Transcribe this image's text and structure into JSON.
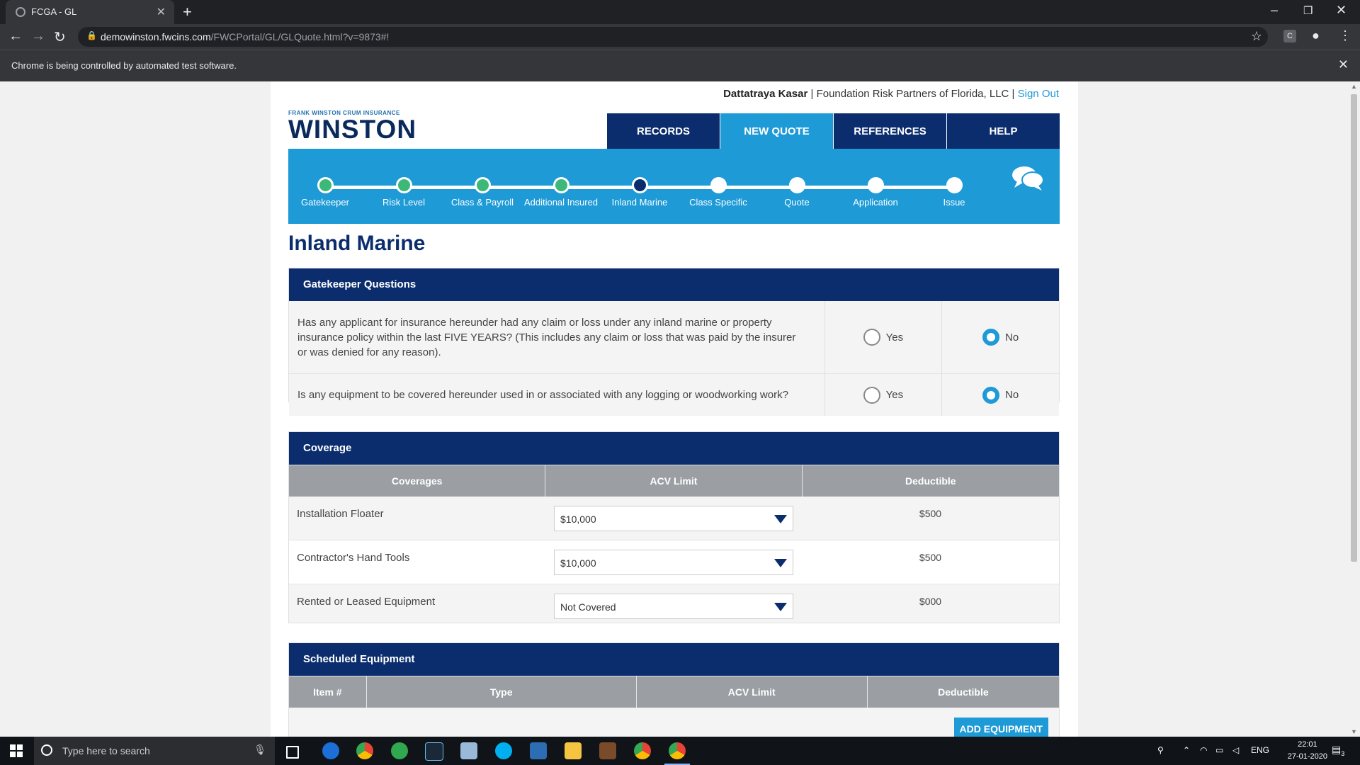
{
  "browser": {
    "tab_title": "FCGA - GL",
    "url_host": "demowinston.fwcins.com",
    "url_path": "/FWCPortal/GL/GLQuote.html?v=9873#!",
    "infobar": "Chrome is being controlled by automated test software.",
    "profile_ext": "C"
  },
  "user": {
    "name": "Dattatraya Kasar",
    "company": "Foundation Risk Partners of Florida, LLC",
    "signout": "Sign Out",
    "separator": "|"
  },
  "logo": {
    "small": "FRANK WINSTON CRUM INSURANCE",
    "big": "WINSTON"
  },
  "nav": {
    "records": "RECORDS",
    "new_quote": "NEW QUOTE",
    "references": "REFERENCES",
    "help": "HELP",
    "active": "NEW QUOTE"
  },
  "steps": [
    {
      "label": "Gatekeeper",
      "state": "done"
    },
    {
      "label": "Risk Level",
      "state": "done"
    },
    {
      "label": "Class & Payroll",
      "state": "done"
    },
    {
      "label": "Additional Insured",
      "state": "done"
    },
    {
      "label": "Inland Marine",
      "state": "current"
    },
    {
      "label": "Class Specific",
      "state": "todo"
    },
    {
      "label": "Quote",
      "state": "todo"
    },
    {
      "label": "Application",
      "state": "todo"
    },
    {
      "label": "Issue",
      "state": "todo"
    }
  ],
  "page_title": "Inland Marine",
  "gatekeeper": {
    "header": "Gatekeeper Questions",
    "yes_label": "Yes",
    "no_label": "No",
    "questions": [
      {
        "text": "Has any applicant for insurance hereunder had any claim or loss under any inland marine or property insurance policy within the last FIVE YEARS? (This includes any claim or loss that was paid by the insurer or was denied for any reason).",
        "answer": "No"
      },
      {
        "text": "Is any equipment to be covered hereunder used in or associated with any logging or woodworking work?",
        "answer": "No"
      }
    ]
  },
  "coverage": {
    "header": "Coverage",
    "columns": [
      "Coverages",
      "ACV Limit",
      "Deductible"
    ],
    "rows": [
      {
        "name": "Installation Floater",
        "limit": "$10,000",
        "deductible": "$500"
      },
      {
        "name": "Contractor's Hand Tools",
        "limit": "$10,000",
        "deductible": "$500"
      },
      {
        "name": "Rented or Leased Equipment",
        "limit": "Not Covered",
        "deductible": "$000"
      }
    ]
  },
  "scheduled": {
    "header": "Scheduled Equipment",
    "columns": [
      "Item #",
      "Type",
      "ACV Limit",
      "Deductible"
    ],
    "add_button": "ADD EQUIPMENT"
  },
  "taskbar": {
    "search_placeholder": "Type here to search",
    "lang": "ENG",
    "time": "22:01",
    "date": "27-01-2020",
    "notifications": "3"
  }
}
